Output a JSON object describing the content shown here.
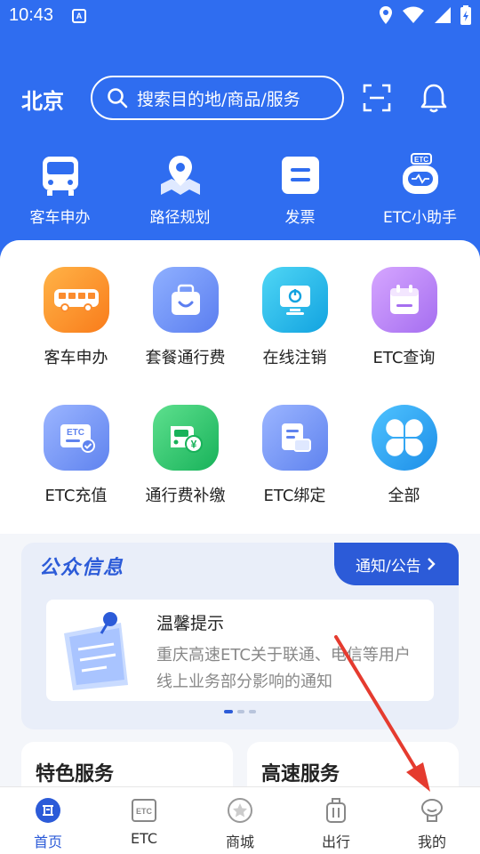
{
  "status_bar": {
    "time": "10:43",
    "app_icon_letter": "A"
  },
  "header": {
    "city": "北京",
    "search_placeholder": "搜索目的地/商品/服务"
  },
  "quick_actions": [
    {
      "label": "客车申办",
      "icon": "bus-front-icon"
    },
    {
      "label": "路径规划",
      "icon": "map-pin-icon"
    },
    {
      "label": "发票",
      "icon": "invoice-icon"
    },
    {
      "label": "ETC小助手",
      "icon": "etc-robot-icon"
    }
  ],
  "service_grid": [
    {
      "label": "客车申办",
      "icon": "bus-icon",
      "color": "#fb8c2e"
    },
    {
      "label": "套餐通行费",
      "icon": "package-bag-icon",
      "color": "#6b8ef5"
    },
    {
      "label": "在线注销",
      "icon": "monitor-power-icon",
      "color": "#1fb8e8"
    },
    {
      "label": "ETC查询",
      "icon": "calendar-icon",
      "color": "#b47ff0"
    },
    {
      "label": "ETC充值",
      "icon": "etc-card-icon",
      "color": "#6f92f2"
    },
    {
      "label": "通行费补缴",
      "icon": "car-yuan-icon",
      "color": "#2cc36b"
    },
    {
      "label": "ETC绑定",
      "icon": "document-card-icon",
      "color": "#6f92f2"
    },
    {
      "label": "全部",
      "icon": "clover-icon",
      "color": "#29a9ef"
    }
  ],
  "info": {
    "title": "公众信息",
    "notice_tab": "通知/公告",
    "notice_heading": "温馨提示",
    "notice_text": "重庆高速ETC关于联通、电信等用户线上业务部分影响的通知"
  },
  "sections": {
    "featured": "特色服务",
    "highway": "高速服务"
  },
  "bottom_nav": [
    {
      "label": "首页",
      "icon": "home-icon",
      "active": true
    },
    {
      "label": "ETC",
      "icon": "etc-tab-icon",
      "active": false
    },
    {
      "label": "商城",
      "icon": "mall-icon",
      "active": false
    },
    {
      "label": "出行",
      "icon": "luggage-icon",
      "active": false
    },
    {
      "label": "我的",
      "icon": "profile-icon",
      "active": false
    }
  ],
  "colors": {
    "brand_blue": "#2f6df0",
    "accent_blue": "#2c5bd8",
    "annotation_red": "#e53b2f"
  }
}
